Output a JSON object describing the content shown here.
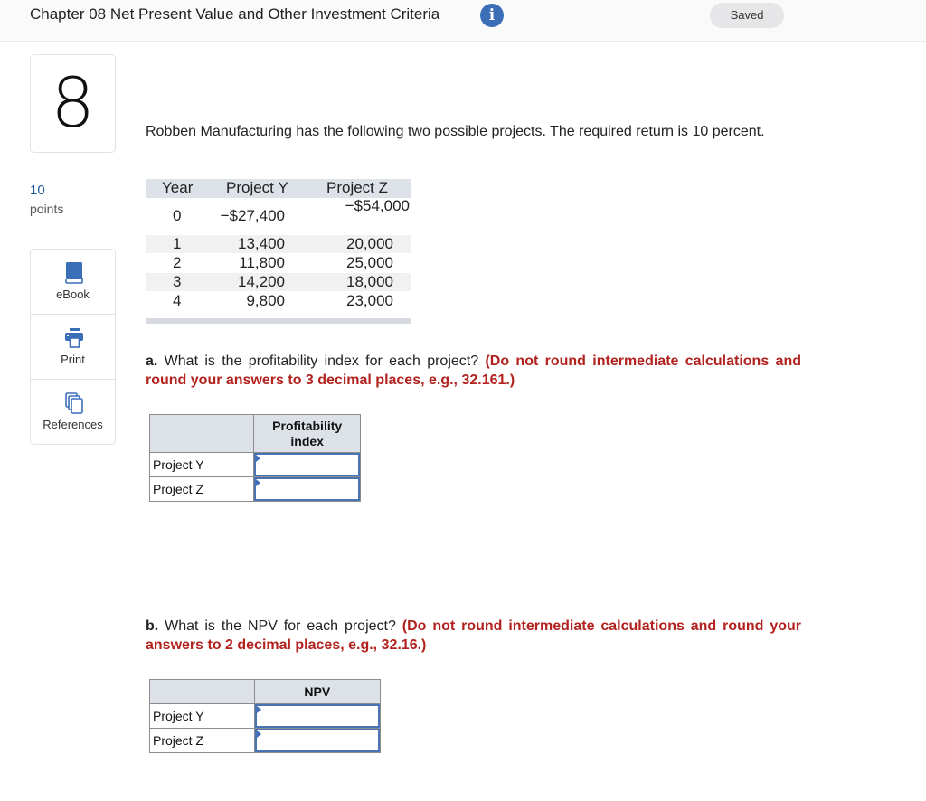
{
  "header": {
    "chapter_title": "Chapter 08 Net Present Value and Other Investment Criteria",
    "info_icon": "info-icon",
    "status_badge": "Saved"
  },
  "sidebar": {
    "question_number": "8",
    "points_value": "10",
    "points_label": "points",
    "tools": [
      {
        "label": "eBook",
        "icon": "book-icon"
      },
      {
        "label": "Print",
        "icon": "printer-icon"
      },
      {
        "label": "References",
        "icon": "documents-icon"
      }
    ]
  },
  "problem": {
    "intro": "Robben Manufacturing has the following two possible projects. The required return is 10 percent.",
    "cash_flow_table": {
      "headers": [
        "Year",
        "Project Y",
        "Project Z"
      ],
      "rows": [
        {
          "year": "0",
          "y": "−$27,400",
          "z": "−$54,000"
        },
        {
          "year": "1",
          "y": "13,400",
          "z": "20,000"
        },
        {
          "year": "2",
          "y": "11,800",
          "z": "25,000"
        },
        {
          "year": "3",
          "y": "14,200",
          "z": "18,000"
        },
        {
          "year": "4",
          "y": "9,800",
          "z": "23,000"
        }
      ]
    }
  },
  "part_a": {
    "letter": "a.",
    "question": " What is the profitability index for each project? ",
    "instruction": "(Do not round intermediate calculations and round your answers to 3 decimal places, e.g., 32.161.)",
    "column_header": "Profitability index",
    "rows": [
      {
        "label": "Project Y",
        "value": ""
      },
      {
        "label": "Project Z",
        "value": ""
      }
    ]
  },
  "part_b": {
    "letter": "b.",
    "question": " What is the NPV for each project? ",
    "instruction": "(Do not round intermediate calculations and round your answers to 2 decimal places, e.g., 32.16.)",
    "column_header": "NPV",
    "rows": [
      {
        "label": "Project Y",
        "value": ""
      },
      {
        "label": "Project Z",
        "value": ""
      }
    ]
  },
  "colors": {
    "accent_blue": "#3a6fb8",
    "instruction_red": "#b2221f",
    "header_gray": "#dde1e8"
  }
}
